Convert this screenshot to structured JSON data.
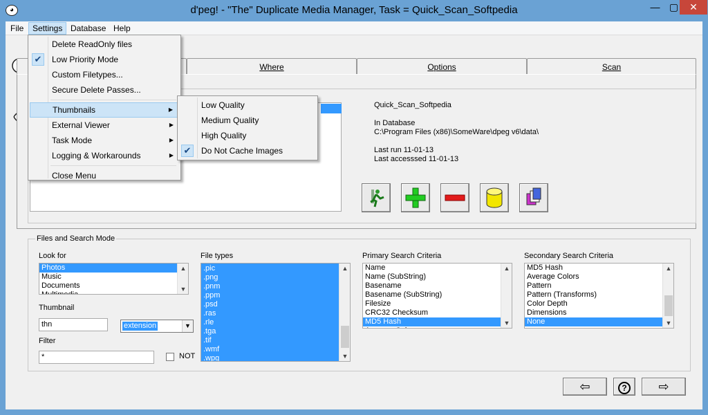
{
  "window": {
    "title": "d'peg! - \"The\" Duplicate Media Manager, Task = Quick_Scan_Softpedia",
    "minimize": "—",
    "maximize": "▢",
    "close": "✕"
  },
  "menubar": {
    "file": "File",
    "settings": "Settings",
    "database": "Database",
    "help": "Help"
  },
  "settings_menu": {
    "items": [
      {
        "label": "Delete ReadOnly files"
      },
      {
        "label": "Low Priority Mode",
        "checked": true
      },
      {
        "label": "Custom Filetypes..."
      },
      {
        "label": "Secure Delete Passes..."
      },
      {
        "label": "Thumbnails",
        "submenu": true,
        "highlighted": true
      },
      {
        "label": "External Viewer",
        "submenu": true
      },
      {
        "label": "Task Mode",
        "submenu": true
      },
      {
        "label": "Logging & Workarounds",
        "submenu": true
      },
      {
        "label": "Close Menu"
      }
    ]
  },
  "thumbnails_menu": {
    "items": [
      {
        "label": "Low Quality"
      },
      {
        "label": "Medium Quality"
      },
      {
        "label": "High Quality"
      },
      {
        "label": "Do Not Cache Images",
        "checked": true
      }
    ]
  },
  "tabs": {
    "where": "Where",
    "options": "Options",
    "scan": "Scan"
  },
  "task_info": {
    "name": "Quick_Scan_Softpedia",
    "in_database": "In Database",
    "path": "C:\\Program Files (x86)\\SomeWare\\dpeg v6\\data\\",
    "last_run": "Last run 11-01-13",
    "last_accessed": "Last accesssed 11-01-13"
  },
  "toolbar_icons": [
    "run-icon",
    "add-icon",
    "remove-icon",
    "database-icon",
    "copy-icon"
  ],
  "files_search": {
    "group_title": "Files and Search Mode",
    "look_for_label": "Look for",
    "look_for_items": [
      "Photos",
      "Music",
      "Documents",
      "Multimedia"
    ],
    "look_for_selected": 0,
    "thumbnail_label": "Thumbnail",
    "thumbnail_value": "thn",
    "thumbnail_mode": "extension",
    "filter_label": "Filter",
    "filter_value": "*",
    "not_label": "NOT",
    "file_types_label": "File types",
    "file_types": [
      ".pic",
      ".png",
      ".pnm",
      ".ppm",
      ".psd",
      ".ras",
      ".rle",
      ".tga",
      ".tif",
      ".wmf",
      ".wpg"
    ],
    "primary_label": "Primary Search Criteria",
    "primary_items": [
      "Name",
      "Name (SubString)",
      "Basename",
      "Basename (SubString)",
      "Filesize",
      "CRC32 Checksum",
      "MD5 Hash",
      "Average Colors"
    ],
    "primary_selected": 6,
    "secondary_label": "Secondary Search Criteria",
    "secondary_items": [
      "MD5 Hash",
      "Average Colors",
      "Pattern",
      "Pattern (Transforms)",
      "Color Depth",
      "Dimensions",
      "None"
    ],
    "secondary_selected": 6
  },
  "nav": {
    "back": "⇦",
    "help": "?",
    "forward": "⇨"
  },
  "colors": {
    "accent": "#3399ff",
    "titlebar": "#6aa2d4",
    "close": "#c7463a",
    "menu_highlight": "#cce4f7"
  }
}
